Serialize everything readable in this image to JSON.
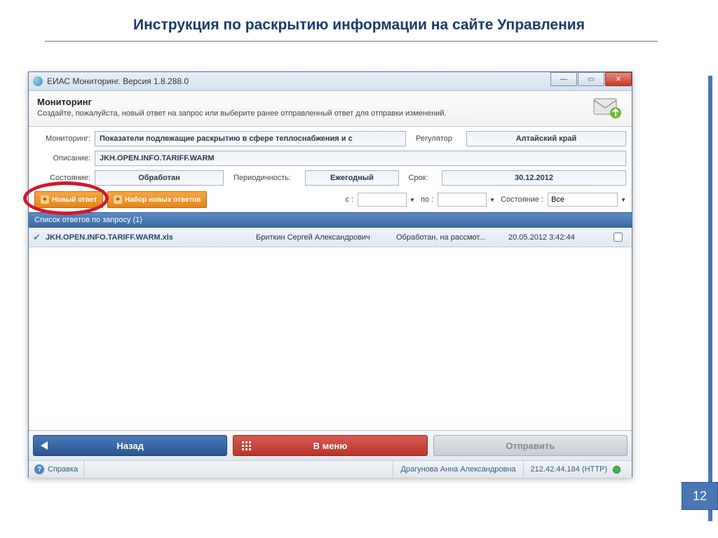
{
  "slide": {
    "title": "Инструкция по раскрытию информации на сайте Управления",
    "pageNumber": "12"
  },
  "window": {
    "title": "ЕИАС Мониторинг. Версия 1.8.288.0"
  },
  "header": {
    "title": "Мониторинг",
    "subtitle": "Создайте, пожалуйста, новый ответ на запрос или выберите ранее отправленный ответ для отправки изменений."
  },
  "form": {
    "monitoringLabel": "Мониторинг:",
    "monitoringValue": "Показатели подлежащие раскрытию в сфере теплоснабжения и с",
    "regulatorLabel": "Регулятор",
    "regulatorValue": "Алтайский край",
    "descriptionLabel": "Описание:",
    "descriptionValue": "JKH.OPEN.INFO.TARIFF.WARM",
    "stateLabel": "Состояние:",
    "stateValue": "Обработан",
    "periodicityLabel": "Периодичность:",
    "periodicityValue": "Ежегодный",
    "deadlineLabel": "Срок:",
    "deadlineValue": "30.12.2012"
  },
  "toolbar": {
    "newAnswer": "Новый ответ",
    "newAnswerSet": "Набор новых ответов",
    "fromLabel": "с :",
    "toLabel": "по :",
    "stateLabel": "Состояние :",
    "stateFilterValue": "Все"
  },
  "list": {
    "header": "Список ответов по запросу (1)",
    "rows": [
      {
        "file": "JKH.OPEN.INFO.TARIFF.WARM.xls",
        "author": "Бриткин Сергей Александрович",
        "status": "Обработан, на рассмот...",
        "date": "20.05.2012 3:42:44"
      }
    ]
  },
  "footer": {
    "back": "Назад",
    "menu": "В меню",
    "send": "Отправить"
  },
  "statusbar": {
    "help": "Справка",
    "user": "Драгунова Анна Александровна",
    "ip": "212.42.44.184 (HTTP)"
  }
}
